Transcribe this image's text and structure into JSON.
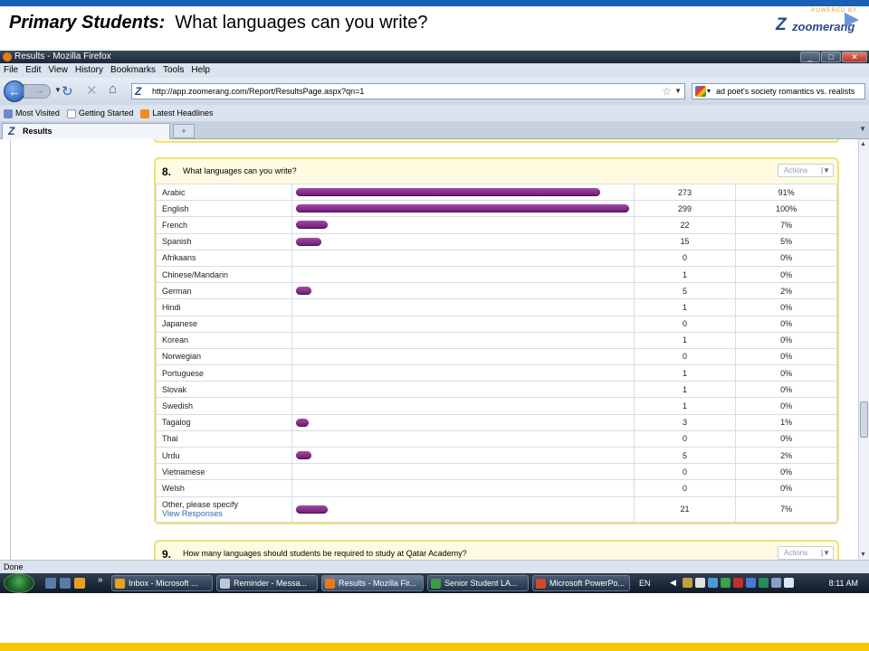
{
  "slide": {
    "title_bold": "Primary Students:",
    "title_rest": "What languages can you write?",
    "logo_powered": "POWERED BY",
    "logo_word": "zoomerang"
  },
  "window": {
    "title": "Results - Mozilla Firefox",
    "minimize": "_",
    "maximize": "□",
    "close": "✕"
  },
  "menu": [
    "File",
    "Edit",
    "View",
    "History",
    "Bookmarks",
    "Tools",
    "Help"
  ],
  "nav": {
    "url": "http://app.zoomerang.com/Report/ResultsPage.aspx?qn=1",
    "search_value": "ad poet's society romantics vs. realists"
  },
  "bookmarks": [
    "Most Visited",
    "Getting Started",
    "Latest Headlines"
  ],
  "tab": {
    "label": "Results",
    "new_tab": "+"
  },
  "question8": {
    "number": "8.",
    "text": "What languages can you write?",
    "actions": "Actions",
    "rows": [
      {
        "label": "Arabic",
        "count": "273",
        "pct": "91%",
        "frac": 0.91
      },
      {
        "label": "English",
        "count": "299",
        "pct": "100%",
        "frac": 1.0
      },
      {
        "label": "French",
        "count": "22",
        "pct": "7%",
        "frac": 0.07
      },
      {
        "label": "Spanish",
        "count": "15",
        "pct": "5%",
        "frac": 0.05
      },
      {
        "label": "Afrikaans",
        "count": "0",
        "pct": "0%",
        "frac": 0
      },
      {
        "label": "Chinese/Mandarin",
        "count": "1",
        "pct": "0%",
        "frac": 0
      },
      {
        "label": "German",
        "count": "5",
        "pct": "2%",
        "frac": 0.02
      },
      {
        "label": "Hindi",
        "count": "1",
        "pct": "0%",
        "frac": 0
      },
      {
        "label": "Japanese",
        "count": "0",
        "pct": "0%",
        "frac": 0
      },
      {
        "label": "Korean",
        "count": "1",
        "pct": "0%",
        "frac": 0
      },
      {
        "label": "Norwegian",
        "count": "0",
        "pct": "0%",
        "frac": 0
      },
      {
        "label": "Portuguese",
        "count": "1",
        "pct": "0%",
        "frac": 0
      },
      {
        "label": "Slovak",
        "count": "1",
        "pct": "0%",
        "frac": 0
      },
      {
        "label": "Swedish",
        "count": "1",
        "pct": "0%",
        "frac": 0
      },
      {
        "label": "Tagalog",
        "count": "3",
        "pct": "1%",
        "frac": 0.01
      },
      {
        "label": "Thai",
        "count": "0",
        "pct": "0%",
        "frac": 0
      },
      {
        "label": "Urdu",
        "count": "5",
        "pct": "2%",
        "frac": 0.02
      },
      {
        "label": "Vietnamese",
        "count": "0",
        "pct": "0%",
        "frac": 0
      },
      {
        "label": "Welsh",
        "count": "0",
        "pct": "0%",
        "frac": 0
      }
    ],
    "other": {
      "label": "Other, please specify",
      "link": "View Responses",
      "count": "21",
      "pct": "7%",
      "frac": 0.07
    }
  },
  "question9": {
    "number": "9.",
    "text": "How many languages should students be required to study at Qatar Academy?",
    "actions": "Actions"
  },
  "status": "Done",
  "taskbar": {
    "items": [
      {
        "label": "Inbox - Microsoft ...",
        "color": "#e8a020"
      },
      {
        "label": "Reminder - Messa...",
        "color": "#c0c8d4"
      },
      {
        "label": "Results - Mozilla Fir...",
        "color": "#e87a1a"
      },
      {
        "label": "Senior Student LA...",
        "color": "#3a9a4a"
      },
      {
        "label": "Microsoft PowerPo...",
        "color": "#d04a2a"
      }
    ],
    "lang": "EN",
    "clock": "8:11 AM"
  },
  "colors": {
    "accent_blue": "#1a5fb4",
    "accent_yellow": "#f7c800",
    "bar_purple": "#8a2a90"
  }
}
